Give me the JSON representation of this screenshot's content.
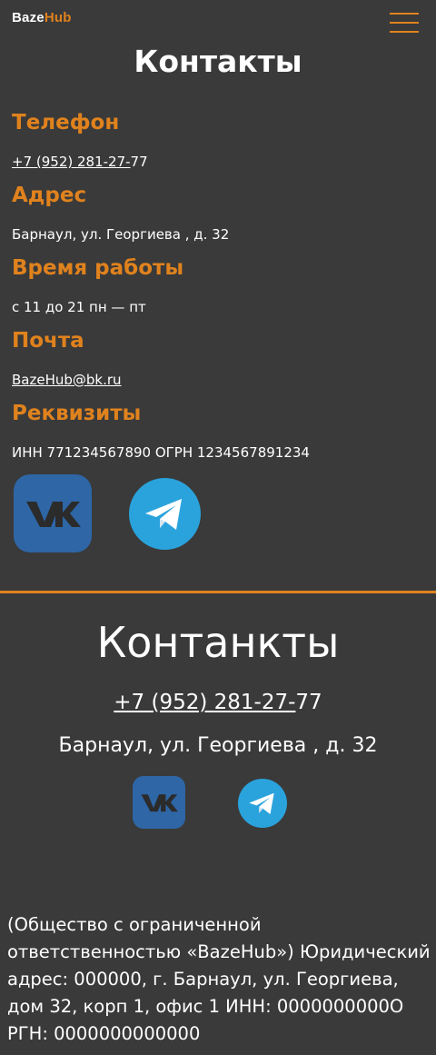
{
  "header": {
    "logo_part1": "Baze",
    "logo_part2": "Hub",
    "menu_icon": "hamburger-menu-icon"
  },
  "page_title": "Контакты",
  "sections": {
    "phone_heading": "Телефон",
    "phone_value": "+7 (952) 281-27-77",
    "phone_link_part": "+7 (952) 281-27-",
    "phone_rest_part": "77",
    "address_heading": "Адрес",
    "address_value": "Барнаул, ул. Георгиева , д. 32",
    "hours_heading": "Время работы",
    "hours_value": "с 11 до 21 пн — пт",
    "email_heading": "Почта",
    "email_value": "BazeHub@bk.ru",
    "requisites_heading": "Реквизиты",
    "requisites_value": "ИНН 771234567890 ОГРН 1234567891234"
  },
  "social_icons": [
    "vk-icon",
    "telegram-icon"
  ],
  "footer": {
    "title": "Контанкты",
    "phone_link_part": "+7 (952) 281-27-",
    "phone_rest_part": "77",
    "address": "Барнаул, ул. Георгиева , д. 32",
    "legal_text": "(Общество с ограниченной ответственностью «BazeHub») Юридический адрес: 000000, г. Барнаул, ул. Георгиева, дом 32, корп 1, офис 1 ИНН: 0000000000О РГН: 0000000000000"
  },
  "colors": {
    "background": "#3a3a3a",
    "accent": "#e0821d",
    "vk": "#2e66a6",
    "telegram": "#2aa3dd"
  }
}
